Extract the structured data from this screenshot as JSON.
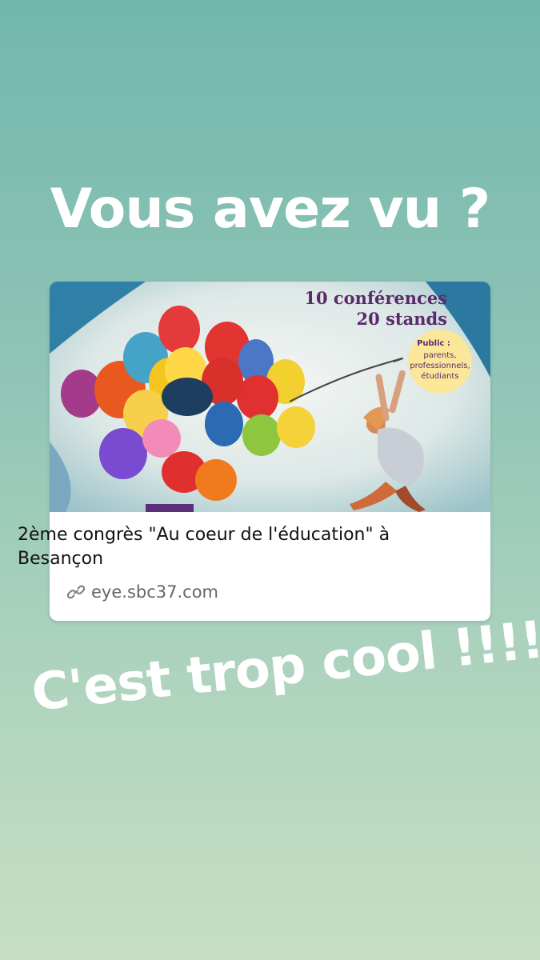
{
  "story": {
    "headline": "Vous avez vu ?",
    "sticker_text": "C'est trop cool !!!!"
  },
  "link_card": {
    "image_text": {
      "line1": "10 conférences",
      "line2": "20 stands",
      "badge_title": "Public :",
      "badge_line1": "parents,",
      "badge_line2": "professionnels,",
      "badge_line3": "étudiants"
    },
    "title": "2ème congrès \"Au coeur de l'éducation\" à Besançon",
    "domain": "eye.sbc37.com",
    "link_icon": "link-icon"
  },
  "colors": {
    "bg_top": "#73b7ac",
    "bg_bottom": "#c7dfc2",
    "text_on_bg": "#ffffff",
    "badge_yellow": "#fbe79a",
    "image_text_purple": "#5a2a6b"
  }
}
